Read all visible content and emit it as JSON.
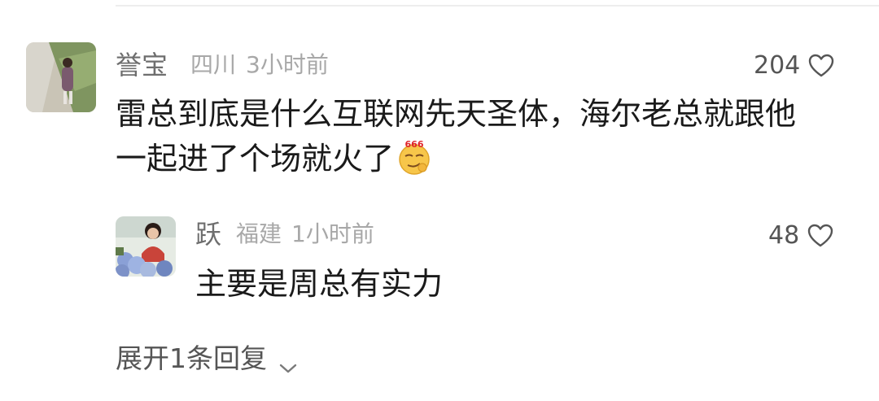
{
  "comment": {
    "username": "誉宝",
    "location": "四川",
    "time": "3小时前",
    "likes": "204",
    "text_line1": "雷总到底是什么互联网先天圣体，海尔老总就跟他",
    "text_line2": "一起进了个场就火了",
    "emoji": "smirk-666-emoji",
    "emoji_text": "666"
  },
  "reply": {
    "username": "跃",
    "location": "福建",
    "time": "1小时前",
    "likes": "48",
    "text": "主要是周总有实力"
  },
  "expand_replies": {
    "label": "展开1条回复",
    "icon": "chevron-down-icon"
  },
  "colors": {
    "username": "#6e6e6e",
    "meta": "#a8a8a8",
    "text": "#1a1a1a",
    "like": "#555555"
  }
}
